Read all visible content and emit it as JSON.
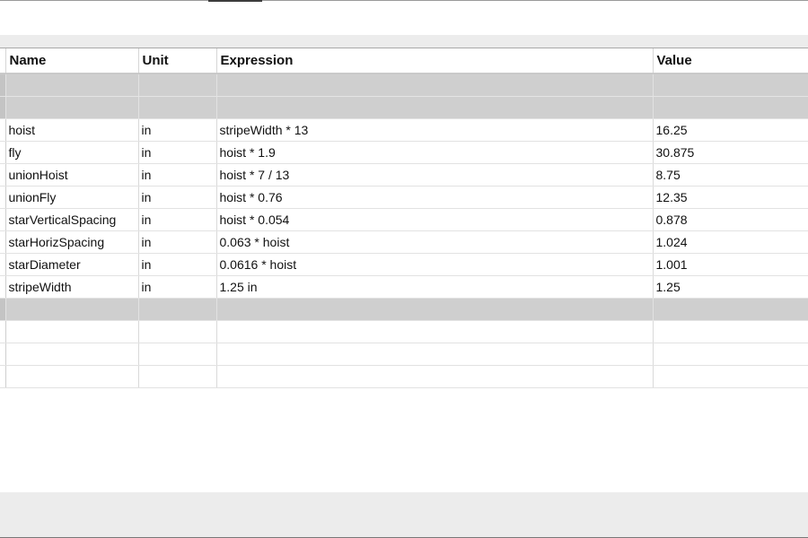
{
  "table": {
    "columns": [
      "Name",
      "Unit",
      "Expression",
      "Value"
    ],
    "rows": [
      {
        "name": "hoist",
        "unit": "in",
        "expression": "stripeWidth * 13",
        "value": "16.25"
      },
      {
        "name": "fly",
        "unit": "in",
        "expression": "hoist * 1.9",
        "value": "30.875"
      },
      {
        "name": "unionHoist",
        "unit": "in",
        "expression": "hoist * 7 / 13",
        "value": "8.75"
      },
      {
        "name": "unionFly",
        "unit": "in",
        "expression": "hoist * 0.76",
        "value": "12.35"
      },
      {
        "name": "starVerticalSpacing",
        "unit": "in",
        "expression": "hoist * 0.054",
        "value": "0.878"
      },
      {
        "name": "starHorizSpacing",
        "unit": "in",
        "expression": "0.063 * hoist",
        "value": "1.024"
      },
      {
        "name": "starDiameter",
        "unit": "in",
        "expression": "0.0616 * hoist",
        "value": "1.001"
      },
      {
        "name": "stripeWidth",
        "unit": "in",
        "expression": "1.25 in",
        "value": "1.25"
      }
    ]
  },
  "colors": {
    "group_row_bg": "#cfcfcf",
    "panel_bg": "#ececec",
    "gridline": "#d9d9d9"
  }
}
